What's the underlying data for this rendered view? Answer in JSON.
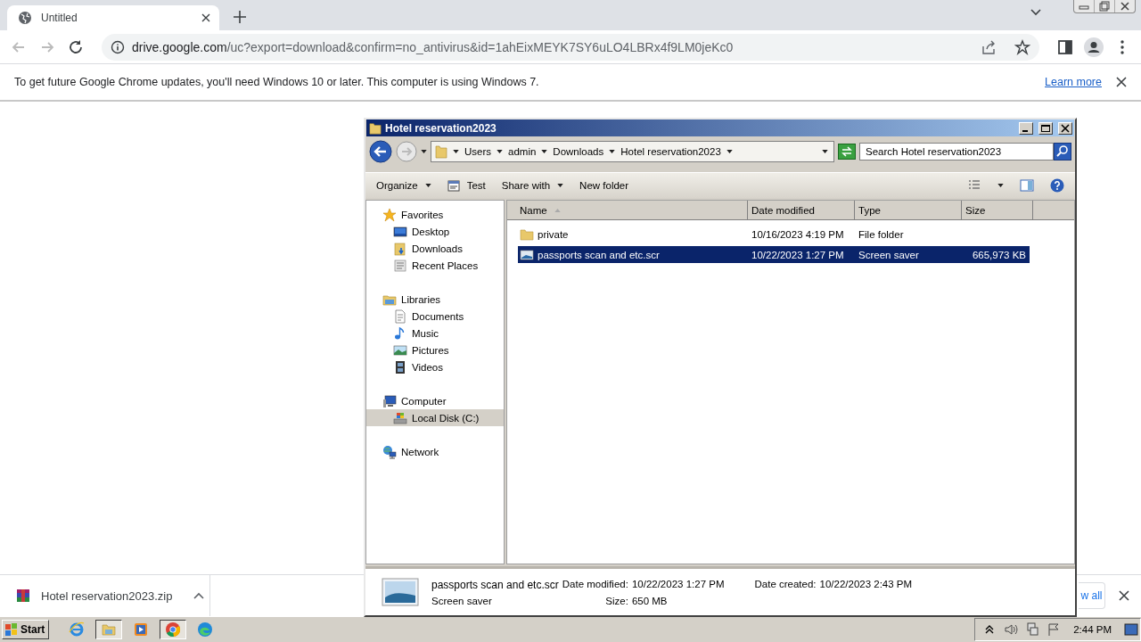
{
  "browser": {
    "tab": {
      "title": "Untitled",
      "selected": true
    },
    "address": {
      "host": "drive.google.com",
      "path": "/uc?export=download&confirm=no_antivirus&id=1ahEixMEYK7SY6uLO4LBRx4f9LM0jeKc0"
    },
    "infobar": {
      "message": "To get future Google Chrome updates, you'll need Windows 10 or later. This computer is using Windows 7.",
      "link": "Learn more"
    }
  },
  "explorer": {
    "title": "Hotel reservation2023",
    "breadcrumb": [
      "Users",
      "admin",
      "Downloads",
      "Hotel reservation2023"
    ],
    "search": {
      "placeholder": "Search Hotel reservation2023"
    },
    "commands": [
      {
        "label": "Organize",
        "kind": "menu"
      },
      {
        "label": "Test",
        "kind": "icon"
      },
      {
        "label": "Share with",
        "kind": "menu"
      },
      {
        "label": "New folder",
        "kind": "plain"
      }
    ],
    "nav": [
      {
        "label": "Favorites",
        "kind": "star",
        "selected": false,
        "children": [
          {
            "label": "Desktop",
            "kind": "desktop",
            "selected": false
          },
          {
            "label": "Downloads",
            "kind": "downloads",
            "selected": false
          },
          {
            "label": "Recent Places",
            "kind": "recent",
            "selected": false
          }
        ]
      },
      {
        "label": "Libraries",
        "kind": "library",
        "selected": false,
        "children": [
          {
            "label": "Documents",
            "kind": "document",
            "selected": false
          },
          {
            "label": "Music",
            "kind": "music",
            "selected": false
          },
          {
            "label": "Pictures",
            "kind": "pictures",
            "selected": false
          },
          {
            "label": "Videos",
            "kind": "videos",
            "selected": false
          }
        ]
      },
      {
        "label": "Computer",
        "kind": "computer",
        "selected": false,
        "children": [
          {
            "label": "Local Disk (C:)",
            "kind": "disk",
            "selected": true
          }
        ]
      },
      {
        "label": "Network",
        "kind": "network",
        "selected": false
      }
    ],
    "columns": [
      "Name",
      "Date modified",
      "Type",
      "Size"
    ],
    "files": [
      {
        "name": "private",
        "date_modified": "10/16/2023 4:19 PM",
        "type": "File folder",
        "kind": "folder",
        "selected": false
      },
      {
        "name": "passports scan and etc.scr",
        "date_modified": "10/22/2023 1:27 PM",
        "type": "Screen saver",
        "size": "665,973 KB",
        "kind": "screensaver",
        "selected": true
      }
    ],
    "details": {
      "name": "passports scan and etc.scr",
      "type": "Screen saver",
      "fields": [
        {
          "label": "Date modified:",
          "value": "10/22/2023 1:27 PM"
        },
        {
          "label": "Date created:",
          "value": "10/22/2023 2:43 PM"
        },
        {
          "label": "Size:",
          "value": "650 MB"
        }
      ]
    }
  },
  "download_bar": {
    "file": "Hotel reservation2023.zip",
    "show_all": "w all"
  },
  "taskbar": {
    "start": "Start",
    "apps": [
      {
        "kind": "ie",
        "active": false
      },
      {
        "kind": "explorer",
        "active": true
      },
      {
        "kind": "media",
        "active": false
      },
      {
        "kind": "chrome",
        "active": true
      },
      {
        "kind": "edge",
        "active": false
      }
    ],
    "clock": "2:44 PM"
  }
}
